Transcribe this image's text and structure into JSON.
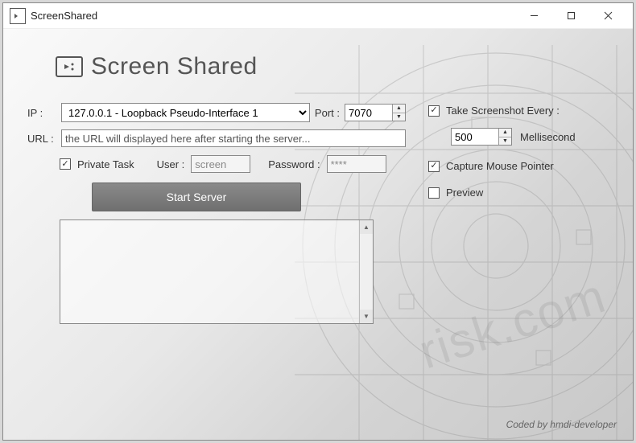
{
  "window": {
    "title": "ScreenShared"
  },
  "logo": {
    "text": "Screen Shared"
  },
  "form": {
    "ip_label": "IP :",
    "ip_value": "127.0.0.1 - Loopback Pseudo-Interface 1",
    "port_label": "Port :",
    "port_value": "7070",
    "url_label": "URL :",
    "url_value": "the URL will displayed here after starting the server...",
    "private_task_label": "Private Task",
    "private_task_checked": true,
    "user_label": "User :",
    "user_value": "screen",
    "password_label": "Password :",
    "password_value": "****",
    "start_button": "Start Server"
  },
  "right": {
    "screenshot_every_label": "Take Screenshot Every :",
    "screenshot_every_checked": true,
    "interval_value": "500",
    "interval_unit": "Mellisecond",
    "capture_mouse_label": "Capture Mouse Pointer",
    "capture_mouse_checked": true,
    "preview_label": "Preview",
    "preview_checked": false
  },
  "footer": {
    "credit": "Coded by hmdi-developer"
  }
}
